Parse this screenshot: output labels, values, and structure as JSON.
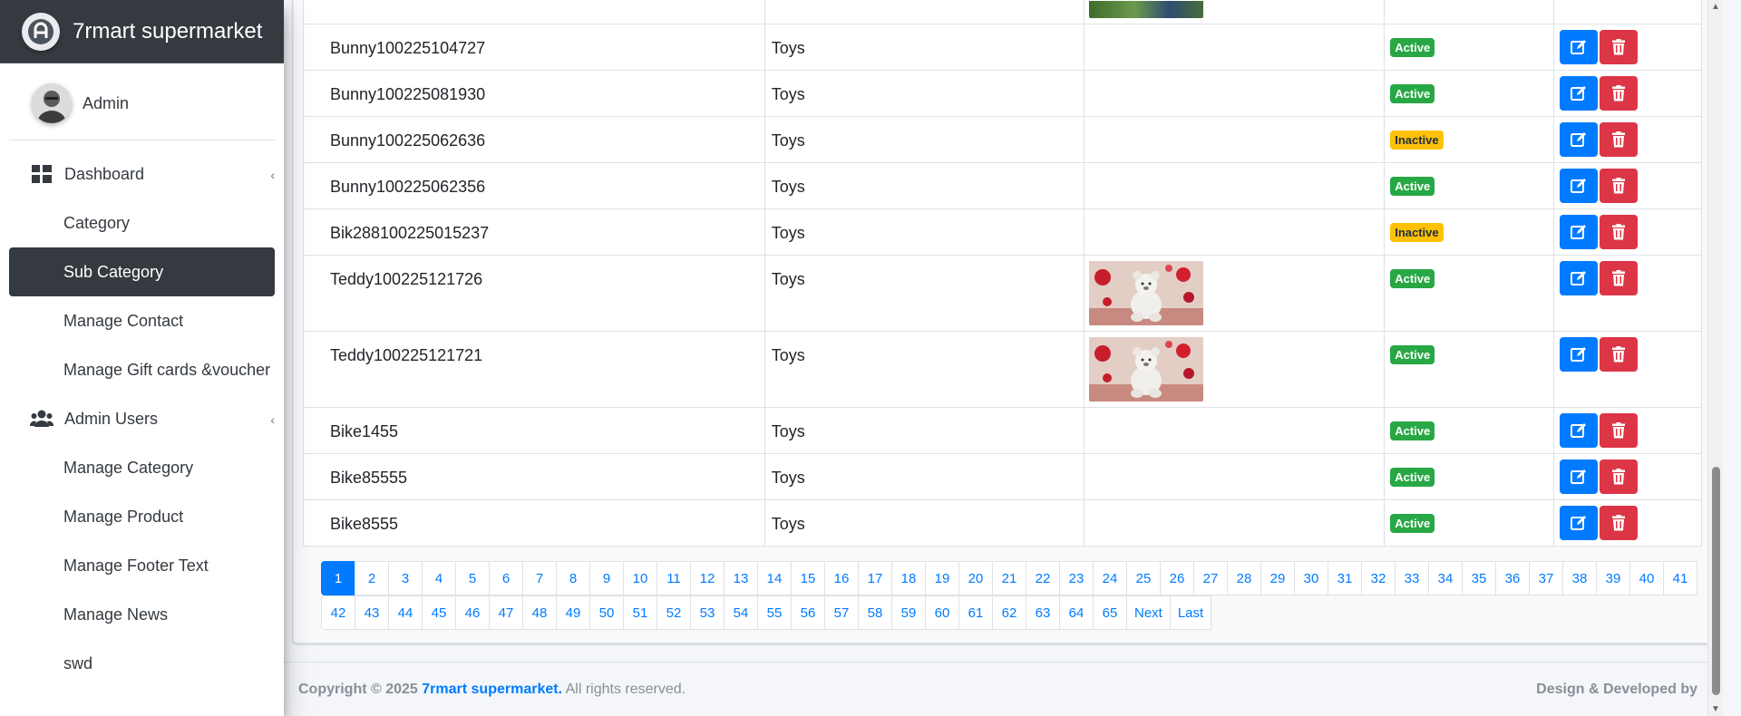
{
  "brand": {
    "name": "7rmart supermarket",
    "icon": "brand-logo-icon"
  },
  "user": {
    "name": "Admin"
  },
  "sidebar": {
    "items": [
      {
        "label": "Dashboard",
        "type": "parent",
        "icon": "dashboard-icon"
      },
      {
        "label": "Category",
        "type": "child"
      },
      {
        "label": "Sub Category",
        "type": "child",
        "active": true
      },
      {
        "label": "Manage Contact",
        "type": "child"
      },
      {
        "label": "Manage Gift cards &voucher",
        "type": "child"
      },
      {
        "label": "Admin Users",
        "type": "parent",
        "icon": "users-icon"
      },
      {
        "label": "Manage Category",
        "type": "child"
      },
      {
        "label": "Manage Product",
        "type": "child"
      },
      {
        "label": "Manage Footer Text",
        "type": "child"
      },
      {
        "label": "Manage News",
        "type": "child"
      },
      {
        "label": "swd",
        "type": "child"
      }
    ]
  },
  "table": {
    "rows": [
      {
        "name": "Bunny100225104727",
        "category": "Toys",
        "image": false,
        "status": "Active"
      },
      {
        "name": "Bunny100225081930",
        "category": "Toys",
        "image": false,
        "status": "Active"
      },
      {
        "name": "Bunny100225062636",
        "category": "Toys",
        "image": false,
        "status": "Inactive"
      },
      {
        "name": "Bunny100225062356",
        "category": "Toys",
        "image": false,
        "status": "Active"
      },
      {
        "name": "Bik288100225015237",
        "category": "Toys",
        "image": false,
        "status": "Inactive"
      },
      {
        "name": "Teddy100225121726",
        "category": "Toys",
        "image": true,
        "status": "Active"
      },
      {
        "name": "Teddy100225121721",
        "category": "Toys",
        "image": true,
        "status": "Active"
      },
      {
        "name": "Bike1455",
        "category": "Toys",
        "image": false,
        "status": "Active"
      },
      {
        "name": "Bike85555",
        "category": "Toys",
        "image": false,
        "status": "Active"
      },
      {
        "name": "Bike8555",
        "category": "Toys",
        "image": false,
        "status": "Active"
      }
    ]
  },
  "pagination": {
    "current": "1",
    "row1": [
      "1",
      "2",
      "3",
      "4",
      "5",
      "6",
      "7",
      "8",
      "9",
      "10",
      "11",
      "12",
      "13",
      "14",
      "15",
      "16",
      "17",
      "18",
      "19",
      "20",
      "21",
      "22",
      "23",
      "24",
      "25",
      "26",
      "27",
      "28",
      "29",
      "30",
      "31",
      "32",
      "33",
      "34",
      "35",
      "36",
      "37",
      "38",
      "39",
      "40",
      "41"
    ],
    "row2": [
      "42",
      "43",
      "44",
      "45",
      "46",
      "47",
      "48",
      "49",
      "50",
      "51",
      "52",
      "53",
      "54",
      "55",
      "56",
      "57",
      "58",
      "59",
      "60",
      "61",
      "62",
      "63",
      "64",
      "65",
      "Next",
      "Last"
    ]
  },
  "footer": {
    "copyright_prefix": "Copyright © 2025",
    "brand_link": "7rmart supermarket.",
    "rights": "All rights reserved.",
    "credit": "Design & Developed by"
  },
  "colors": {
    "primary": "#007bff",
    "danger": "#dc3545",
    "success": "#28a745",
    "warning": "#ffc107",
    "dark": "#343a40"
  }
}
